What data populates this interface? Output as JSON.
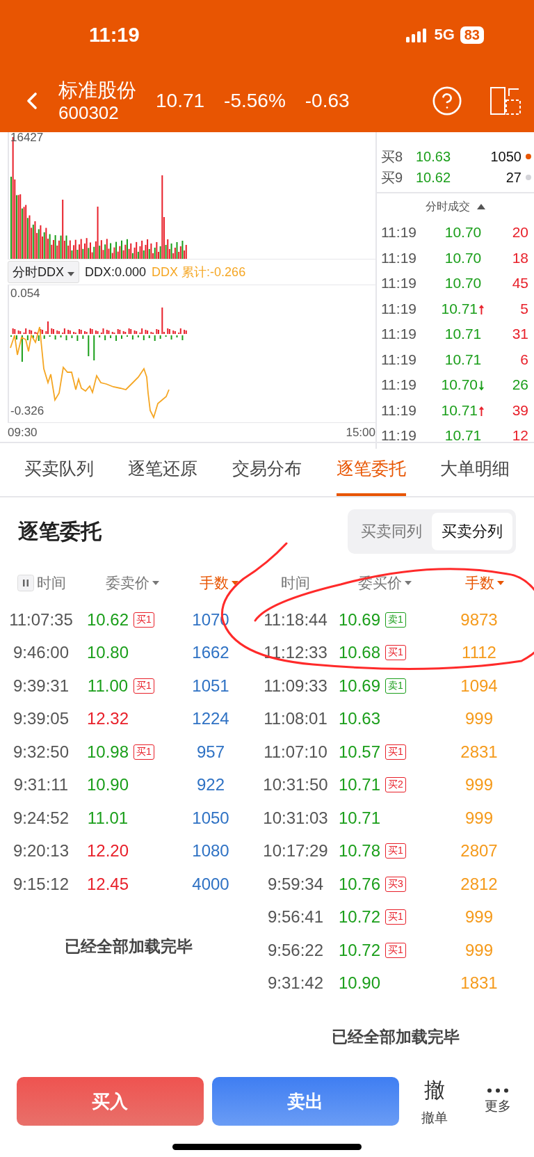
{
  "status_bar": {
    "time": "11:19",
    "network": "5G",
    "battery": "83"
  },
  "header": {
    "name": "标准股份",
    "code": "600302",
    "price": "10.71",
    "change_pct": "-5.56%",
    "change": "-0.63"
  },
  "chart": {
    "volume_max": "16427",
    "indicator": "分时DDX",
    "ddx": "DDX:0.000",
    "ddx_total": "DDX 累计:-0.266",
    "ddx_max": "0.054",
    "ddx_min": "-0.326",
    "time_start": "09:30",
    "time_end": "15:00"
  },
  "order_book": [
    {
      "label": "买8",
      "price": "10.63",
      "volume": "1050",
      "color": "#e85502"
    },
    {
      "label": "买9",
      "price": "10.62",
      "volume": "27",
      "color": "#d3d3d8"
    }
  ],
  "ticks": {
    "title": "分时成交",
    "rows": [
      {
        "time": "11:19",
        "price": "10.70",
        "volume": "20",
        "color": "#e8202a"
      },
      {
        "time": "11:19",
        "price": "10.70",
        "volume": "18",
        "color": "#e8202a"
      },
      {
        "time": "11:19",
        "price": "10.70",
        "volume": "45",
        "color": "#e8202a"
      },
      {
        "time": "11:19",
        "price": "10.71",
        "arrow": {
          "text": "↑",
          "color": "#e8202a"
        },
        "volume": "5",
        "color": "#e8202a"
      },
      {
        "time": "11:19",
        "price": "10.71",
        "volume": "31",
        "color": "#e8202a"
      },
      {
        "time": "11:19",
        "price": "10.71",
        "volume": "6",
        "color": "#e8202a"
      },
      {
        "time": "11:19",
        "price": "10.70",
        "arrow": {
          "text": "↓",
          "color": "#1a9e1a"
        },
        "volume": "26",
        "color": "#1a9e1a"
      },
      {
        "time": "11:19",
        "price": "10.71",
        "arrow": {
          "text": "↑",
          "color": "#e8202a"
        },
        "volume": "39",
        "color": "#e8202a"
      },
      {
        "time": "11:19",
        "price": "10.71",
        "volume": "12",
        "color": "#e8202a"
      }
    ]
  },
  "tabs": [
    {
      "label": "买卖队列",
      "selected": false
    },
    {
      "label": "逐笔还原",
      "selected": false
    },
    {
      "label": "交易分布",
      "selected": false
    },
    {
      "label": "逐笔委托",
      "selected": true
    },
    {
      "label": "大单明细",
      "selected": false
    }
  ],
  "entrust": {
    "title": "逐笔委托",
    "modes": [
      {
        "label": "买卖同列",
        "selected": false
      },
      {
        "label": "买卖分列",
        "selected": true
      }
    ],
    "sides": [
      {
        "kind": "sell",
        "columns": [
          {
            "label": "时间",
            "sortable": false,
            "selected": false
          },
          {
            "label": "委卖价",
            "sortable": true,
            "selected": false
          },
          {
            "label": "手数",
            "sortable": true,
            "selected": true
          }
        ],
        "rows": [
          {
            "time": "11:07:35",
            "price": "10.62",
            "color": "#1a9e1a",
            "tag": {
              "text": "买1",
              "kind": "buy"
            },
            "volume": "1070"
          },
          {
            "time": "9:46:00",
            "price": "10.80",
            "color": "#1a9e1a",
            "volume": "1662"
          },
          {
            "time": "9:39:31",
            "price": "11.00",
            "color": "#1a9e1a",
            "tag": {
              "text": "买1",
              "kind": "buy"
            },
            "volume": "1051"
          },
          {
            "time": "9:39:05",
            "price": "12.32",
            "color": "#e8202a",
            "volume": "1224"
          },
          {
            "time": "9:32:50",
            "price": "10.98",
            "color": "#1a9e1a",
            "tag": {
              "text": "买1",
              "kind": "buy"
            },
            "volume": "957"
          },
          {
            "time": "9:31:11",
            "price": "10.90",
            "color": "#1a9e1a",
            "volume": "922"
          },
          {
            "time": "9:24:52",
            "price": "11.01",
            "color": "#1a9e1a",
            "volume": "1050"
          },
          {
            "time": "9:20:13",
            "price": "12.20",
            "color": "#e8202a",
            "volume": "1080"
          },
          {
            "time": "9:15:12",
            "price": "12.45",
            "color": "#e8202a",
            "volume": "4000"
          }
        ],
        "footer": "已经全部加载完毕"
      },
      {
        "kind": "buy",
        "columns": [
          {
            "label": "时间",
            "sortable": false,
            "selected": false
          },
          {
            "label": "委买价",
            "sortable": true,
            "selected": false
          },
          {
            "label": "手数",
            "sortable": true,
            "selected": true
          }
        ],
        "rows": [
          {
            "time": "11:18:44",
            "price": "10.69",
            "color": "#1a9e1a",
            "tag": {
              "text": "卖1",
              "kind": "sell"
            },
            "volume": "9873"
          },
          {
            "time": "11:12:33",
            "price": "10.68",
            "color": "#1a9e1a",
            "tag": {
              "text": "买1",
              "kind": "buy"
            },
            "volume": "1112"
          },
          {
            "time": "11:09:33",
            "price": "10.69",
            "color": "#1a9e1a",
            "tag": {
              "text": "卖1",
              "kind": "sell"
            },
            "volume": "1094"
          },
          {
            "time": "11:08:01",
            "price": "10.63",
            "color": "#1a9e1a",
            "volume": "999"
          },
          {
            "time": "11:07:10",
            "price": "10.57",
            "color": "#1a9e1a",
            "tag": {
              "text": "买1",
              "kind": "buy"
            },
            "volume": "2831"
          },
          {
            "time": "10:31:50",
            "price": "10.71",
            "color": "#1a9e1a",
            "tag": {
              "text": "买2",
              "kind": "buy"
            },
            "volume": "999"
          },
          {
            "time": "10:31:03",
            "price": "10.71",
            "color": "#1a9e1a",
            "volume": "999"
          },
          {
            "time": "10:17:29",
            "price": "10.78",
            "color": "#1a9e1a",
            "tag": {
              "text": "买1",
              "kind": "buy"
            },
            "volume": "2807"
          },
          {
            "time": "9:59:34",
            "price": "10.76",
            "color": "#1a9e1a",
            "tag": {
              "text": "买3",
              "kind": "buy"
            },
            "volume": "2812"
          },
          {
            "time": "9:56:41",
            "price": "10.72",
            "color": "#1a9e1a",
            "tag": {
              "text": "买1",
              "kind": "buy"
            },
            "volume": "999"
          },
          {
            "time": "9:56:22",
            "price": "10.72",
            "color": "#1a9e1a",
            "tag": {
              "text": "买1",
              "kind": "buy"
            },
            "volume": "999"
          },
          {
            "time": "9:31:42",
            "price": "10.90",
            "color": "#1a9e1a",
            "volume": "1831"
          }
        ],
        "footer": "已经全部加载完毕"
      }
    ]
  },
  "markup": {
    "kind": "freehand-circle"
  },
  "bottom": {
    "buttons": [
      {
        "label": "买入",
        "kind": "buy"
      },
      {
        "label": "卖出",
        "kind": "sell"
      }
    ],
    "actions": [
      {
        "kind": "glyph",
        "glyph": "撤",
        "label": "撤单"
      },
      {
        "kind": "dots",
        "label": "更多"
      }
    ]
  }
}
